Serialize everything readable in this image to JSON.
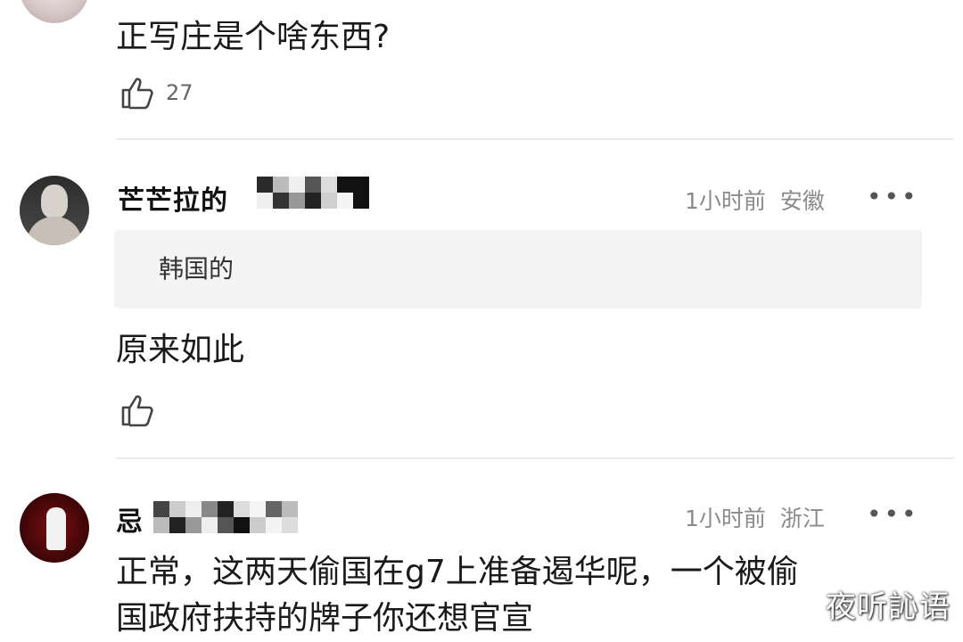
{
  "comments": [
    {
      "text": "正写庄是个啥东西?",
      "like_count": "27",
      "like_icon": "thumbs-up-icon"
    },
    {
      "username": "芒芒拉的",
      "time": "1小时前",
      "location": "安徽",
      "more_icon": "more-dots-icon",
      "quote": "韩国的",
      "text": "原来如此",
      "like_count": "",
      "like_icon": "thumbs-up-icon"
    },
    {
      "username": "忌",
      "time": "1小时前",
      "location": "浙江",
      "more_icon": "more-dots-icon",
      "text_line1": "正常，这两天偷国在g7上准备遏华呢，一个被偷",
      "text_line2": "国政府扶持的牌子你还想官宣"
    }
  ],
  "more_label": "•••",
  "watermark": "夜听訫语"
}
